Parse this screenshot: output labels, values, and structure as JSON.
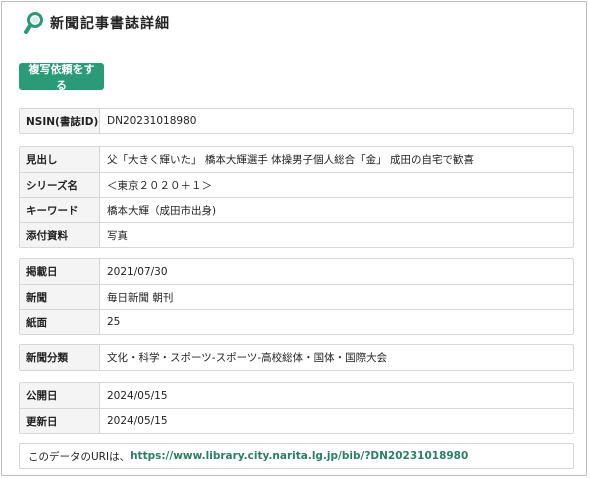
{
  "page": {
    "title": "新聞記事書誌詳細"
  },
  "actions": {
    "copy_request_label": "複写依頼をする"
  },
  "nsin": {
    "label": "NSIN(書誌ID)",
    "value": "DN20231018980"
  },
  "article": [
    {
      "label": "見出し",
      "value": "父「大きく輝いた」 橋本大輝選手 体操男子個人総合「金」 成田の自宅で歓喜"
    },
    {
      "label": "シリーズ名",
      "value": "＜東京２０２０＋１＞"
    },
    {
      "label": "キーワード",
      "value": "橋本大輝（成田市出身)"
    },
    {
      "label": "添付資料",
      "value": "写真"
    }
  ],
  "publication": [
    {
      "label": "掲載日",
      "value": "2021/07/30"
    },
    {
      "label": "新聞",
      "value": "毎日新聞 朝刊"
    },
    {
      "label": "紙面",
      "value": "25"
    }
  ],
  "classification": [
    {
      "label": "新聞分類",
      "value": "文化・科学・スポーツ-スポーツ-高校総体・国体・国際大会"
    }
  ],
  "dates": [
    {
      "label": "公開日",
      "value": "2024/05/15"
    },
    {
      "label": "更新日",
      "value": "2024/05/15"
    }
  ],
  "uri": {
    "prefix": "このデータのURIは、",
    "link": "https://www.library.city.narita.lg.jp/bib/?DN20231018980"
  },
  "icons": {
    "header": "magnifier-icon"
  },
  "colors": {
    "accent": "#2a9b76",
    "link": "#2a7f62",
    "label_bg": "#f4f4f4",
    "border": "#d6d6d6"
  }
}
